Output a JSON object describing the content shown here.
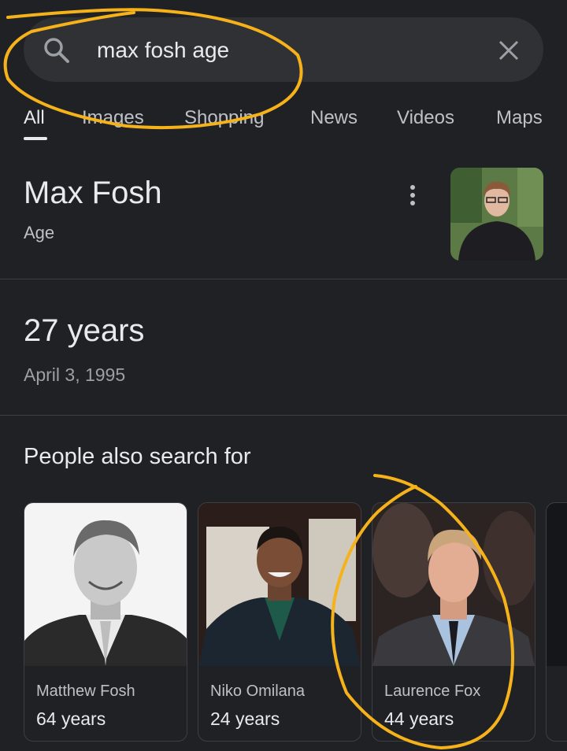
{
  "search": {
    "query": "max fosh age",
    "icon": "search-icon",
    "clear_icon": "close-icon"
  },
  "tabs": [
    {
      "label": "All",
      "active": true
    },
    {
      "label": "Images",
      "active": false
    },
    {
      "label": "Shopping",
      "active": false
    },
    {
      "label": "News",
      "active": false
    },
    {
      "label": "Videos",
      "active": false
    },
    {
      "label": "Maps",
      "active": false
    }
  ],
  "knowledge_panel": {
    "title": "Max Fosh",
    "subtitle": "Age",
    "answer": "27 years",
    "date": "April 3, 1995"
  },
  "people_also_search": {
    "heading": "People also search for",
    "people": [
      {
        "name": "Matthew Fosh",
        "age": "64 years"
      },
      {
        "name": "Niko Omilana",
        "age": "24 years"
      },
      {
        "name": "Laurence Fox",
        "age": "44 years"
      }
    ]
  },
  "colors": {
    "background": "#202124",
    "search_bar": "#303134",
    "text_primary": "#e8eaed",
    "text_secondary": "#9aa0a6",
    "annotation": "#f5b21a"
  }
}
